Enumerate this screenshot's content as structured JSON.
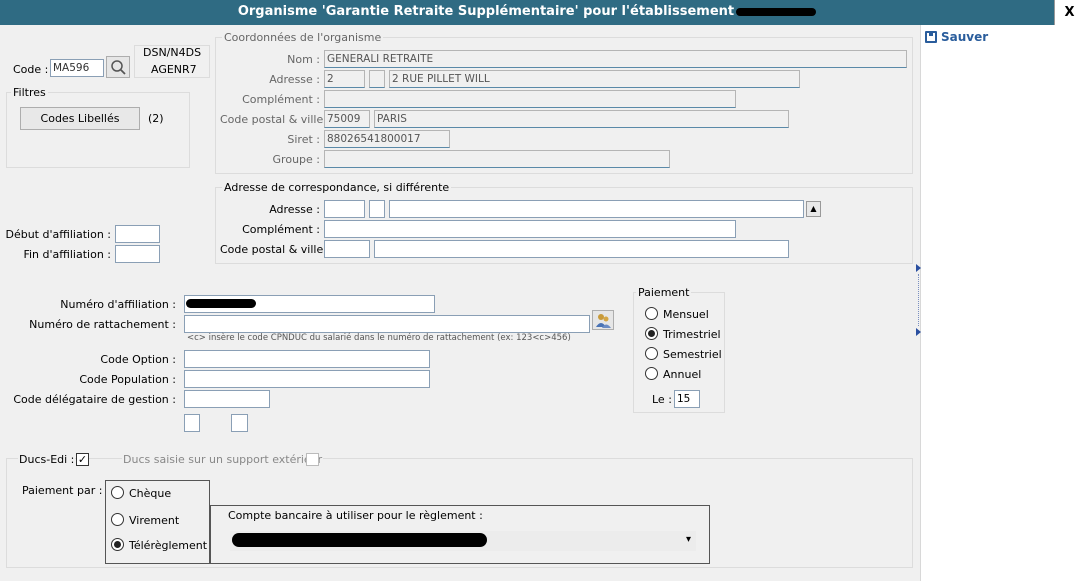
{
  "window": {
    "title": "Organisme 'Garantie Retraite Supplémentaire' pour l'établissement",
    "close_label": "X"
  },
  "toolbar": {
    "save_label": "Sauver"
  },
  "code": {
    "label": "Code :",
    "value": "MA596",
    "dsn_label": "DSN/N4DS",
    "dsn_value": "AGENR7"
  },
  "filters": {
    "title": "Filtres",
    "button_label": "Codes Libellés",
    "count": "(2)"
  },
  "organisme": {
    "title": "Coordonnées de l'organisme",
    "nom_label": "Nom :",
    "nom_value": "GENERALI RETRAITE",
    "adresse_label": "Adresse :",
    "adresse_num": "2",
    "adresse_bis": "",
    "adresse_rue": "2 RUE PILLET WILL",
    "complement_label": "Complément :",
    "complement_value": "",
    "cp_label": "Code postal & ville :",
    "cp_value": "75009",
    "ville_value": "PARIS",
    "siret_label": "Siret :",
    "siret_value": "88026541800017",
    "groupe_label": "Groupe :",
    "groupe_value": ""
  },
  "correspondance": {
    "title": "Adresse de correspondance, si différente",
    "adresse_label": "Adresse :",
    "complement_label": "Complément :",
    "cp_label": "Code postal & ville :",
    "scroll_glyph": "▲"
  },
  "affiliation": {
    "debut_label": "Début d'affiliation :",
    "fin_label": "Fin d'affiliation :"
  },
  "fields": {
    "numero_affiliation_label": "Numéro d'affiliation :",
    "numero_rattachement_label": "Numéro de rattachement :",
    "rattachement_hint": "<c> insère le code CPNDUC du salarié dans le numéro de rattachement (ex: 123<c>456)",
    "code_option_label": "Code Option :",
    "code_population_label": "Code Population :",
    "code_delegataire_label": "Code délégataire de gestion :"
  },
  "paiement": {
    "title": "Paiement",
    "options": [
      "Mensuel",
      "Trimestriel",
      "Semestriel",
      "Annuel"
    ],
    "selected": "Trimestriel",
    "le_label": "Le :",
    "le_value": "15"
  },
  "ducs": {
    "ducs_edi_label": "Ducs-Edi :",
    "ducs_edi_checked": "✓",
    "ducs_saisie_label": "Ducs saisie sur un support extérieur",
    "paiement_par_label": "Paiement par :",
    "methods": [
      "Chèque",
      "Virement",
      "Télérèglement"
    ],
    "selected": "Télérèglement",
    "compte_label": "Compte bancaire à utiliser pour le règlement :",
    "dropdown_arrow": "▾"
  }
}
